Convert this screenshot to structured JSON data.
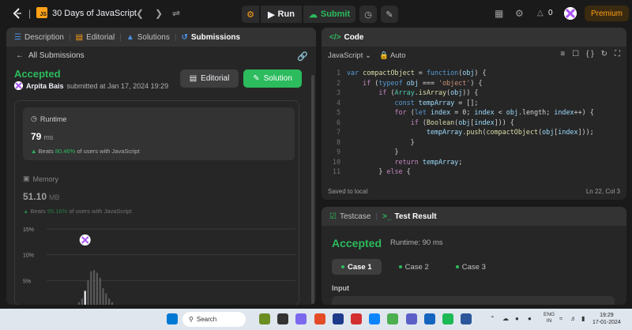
{
  "topbar": {
    "app_title": "30 Days of JavaScript",
    "js_badge": "JS",
    "run_label": "Run",
    "submit_label": "Submit",
    "streak_count": "0",
    "premium_label": "Premium"
  },
  "left_panel": {
    "tabs": [
      {
        "label": "Description",
        "icon": "description-icon"
      },
      {
        "label": "Editorial",
        "icon": "book-icon"
      },
      {
        "label": "Solutions",
        "icon": "flask-icon"
      },
      {
        "label": "Submissions",
        "icon": "history-icon"
      }
    ],
    "back_label": "All Submissions",
    "status": "Accepted",
    "submitter_name": "Arpita Bais",
    "submitted_text": "submitted at Jan 17, 2024 19:29",
    "editorial_button": "Editorial",
    "solution_button": "Solution",
    "runtime": {
      "label": "Runtime",
      "value": "79",
      "unit": "ms",
      "beats_prefix": "Beats",
      "beats_pct": "80.46%",
      "beats_suffix": "of users with JavaScript"
    },
    "memory": {
      "label": "Memory",
      "value": "51.10",
      "unit": "MB",
      "beats_prefix": "Beats",
      "beats_pct": "95.16%",
      "beats_suffix": "of users with JavaScript"
    }
  },
  "chart_data": {
    "type": "bar",
    "ytick_labels": [
      "15%",
      "10%",
      "5%"
    ],
    "ylim": [
      0,
      15
    ],
    "values": [
      0.8,
      1.5,
      3.0,
      5.0,
      6.8,
      7.0,
      6.5,
      5.5,
      3.5,
      2.5,
      1.5,
      0.8
    ],
    "highlight_index": 2
  },
  "code_panel": {
    "title": "Code",
    "language": "JavaScript",
    "mode": "Auto",
    "saved_status": "Saved to local",
    "cursor_pos": "Ln 22, Col 3",
    "lines": [
      {
        "n": "1",
        "text": "var compactObject = function(obj) {"
      },
      {
        "n": "2",
        "text": "    if (typeof obj === 'object') {"
      },
      {
        "n": "3",
        "text": "        if (Array.isArray(obj)) {"
      },
      {
        "n": "4",
        "text": "            const tempArray = [];"
      },
      {
        "n": "5",
        "text": "            for (let index = 0; index < obj.length; index++) {"
      },
      {
        "n": "6",
        "text": "                if (Boolean(obj[index])) {"
      },
      {
        "n": "7",
        "text": "                    tempArray.push(compactObject(obj[index]));"
      },
      {
        "n": "8",
        "text": "                }"
      },
      {
        "n": "9",
        "text": "            }"
      },
      {
        "n": "10",
        "text": "            return tempArray;"
      },
      {
        "n": "11",
        "text": "        } else {"
      }
    ]
  },
  "test_panel": {
    "tab_testcase": "Testcase",
    "tab_result": "Test Result",
    "status": "Accepted",
    "runtime": "Runtime: 90 ms",
    "cases": [
      "Case 1",
      "Case 2",
      "Case 3"
    ],
    "input_label": "Input"
  },
  "taskbar": {
    "search_placeholder": "Search",
    "lang_top": "ENG",
    "lang_bottom": "IN",
    "time": "19:29",
    "date": "17-01-2024"
  }
}
